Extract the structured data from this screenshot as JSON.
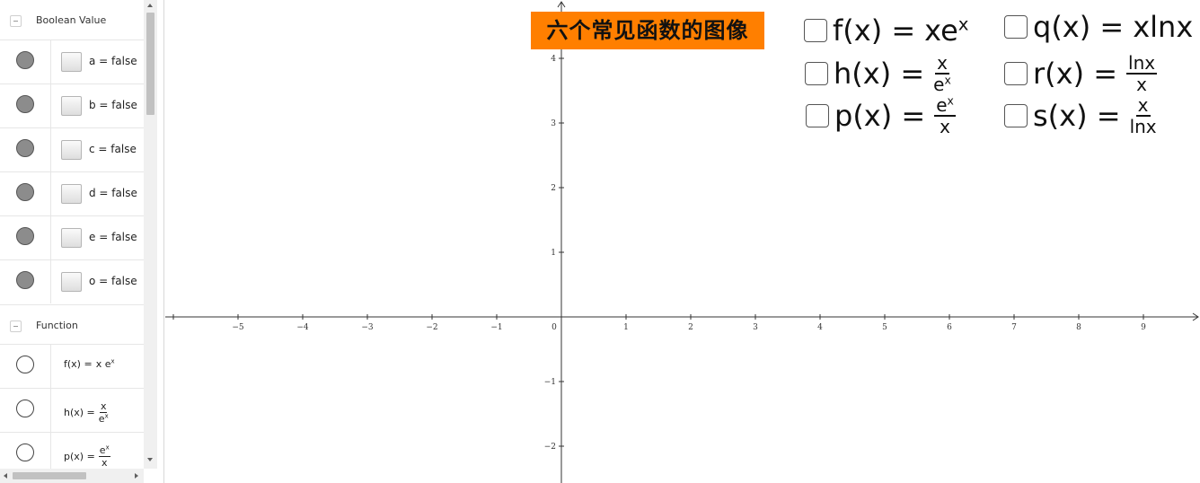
{
  "algebra": {
    "groups": [
      {
        "title": "Boolean Value"
      },
      {
        "title": "Function"
      }
    ],
    "booleans": [
      {
        "label": "a = false"
      },
      {
        "label": "b = false"
      },
      {
        "label": "c = false"
      },
      {
        "label": "d = false"
      },
      {
        "label": "e = false"
      },
      {
        "label": "o = false"
      }
    ],
    "functions": [
      {
        "lhs": "f(x) =",
        "expr": "x e",
        "sup": "x"
      },
      {
        "lhs": "h(x) =",
        "num": "x",
        "den": "e",
        "den_sup": "x"
      },
      {
        "lhs": "p(x) =",
        "num": "e",
        "num_sup": "x",
        "den": "x"
      }
    ]
  },
  "graphics": {
    "title": "六个常见函数的图像",
    "title_bg": "#ff7f00",
    "toggles": [
      {
        "lhs": "f(x) =",
        "expr": "xe",
        "sup": "x"
      },
      {
        "lhs": "q(x) =",
        "expr": "xlnx"
      },
      {
        "lhs": "h(x) =",
        "num": "x",
        "den": "e",
        "den_sup": "x"
      },
      {
        "lhs": "r(x) =",
        "num": "lnx",
        "den": "x"
      },
      {
        "lhs": "p(x) =",
        "num": "e",
        "num_sup": "x",
        "den": "x"
      },
      {
        "lhs": "s(x) =",
        "num": "x",
        "den": "lnx"
      }
    ],
    "axes": {
      "x_ticks": [
        "−5",
        "−4",
        "−3",
        "−2",
        "−1",
        "0",
        "1",
        "2",
        "3",
        "4",
        "5",
        "6",
        "7",
        "8",
        "9"
      ],
      "y_ticks": [
        "4",
        "3",
        "2",
        "1",
        "−1",
        "−2"
      ],
      "xlim": [
        -6,
        10
      ],
      "ylim": [
        -2.5,
        5
      ]
    }
  }
}
